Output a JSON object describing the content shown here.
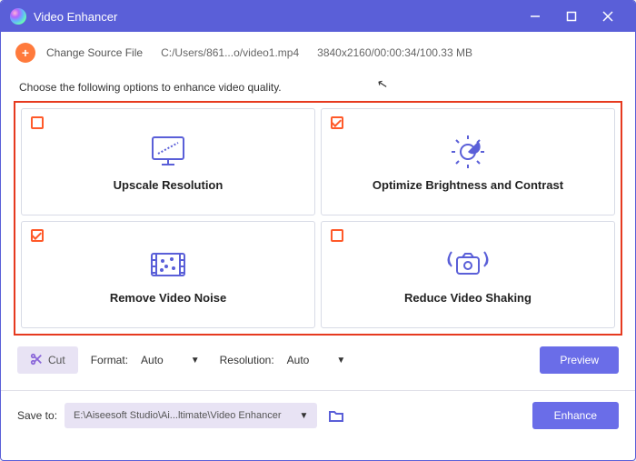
{
  "window": {
    "title": "Video Enhancer"
  },
  "source": {
    "change_label": "Change Source File",
    "path": "C:/Users/861...o/video1.mp4",
    "meta": "3840x2160/00:00:34/100.33 MB"
  },
  "instruction": "Choose the following options to enhance video quality.",
  "options": [
    {
      "key": "upscale",
      "label": "Upscale Resolution",
      "checked": false
    },
    {
      "key": "bright",
      "label": "Optimize Brightness and Contrast",
      "checked": true
    },
    {
      "key": "noise",
      "label": "Remove Video Noise",
      "checked": true
    },
    {
      "key": "shake",
      "label": "Reduce Video Shaking",
      "checked": false
    }
  ],
  "controls": {
    "cut": "Cut",
    "format_label": "Format:",
    "format_value": "Auto",
    "resolution_label": "Resolution:",
    "resolution_value": "Auto",
    "preview": "Preview"
  },
  "bottom": {
    "save_label": "Save to:",
    "save_path": "E:\\Aiseesoft Studio\\Ai...ltimate\\Video Enhancer",
    "enhance": "Enhance"
  }
}
